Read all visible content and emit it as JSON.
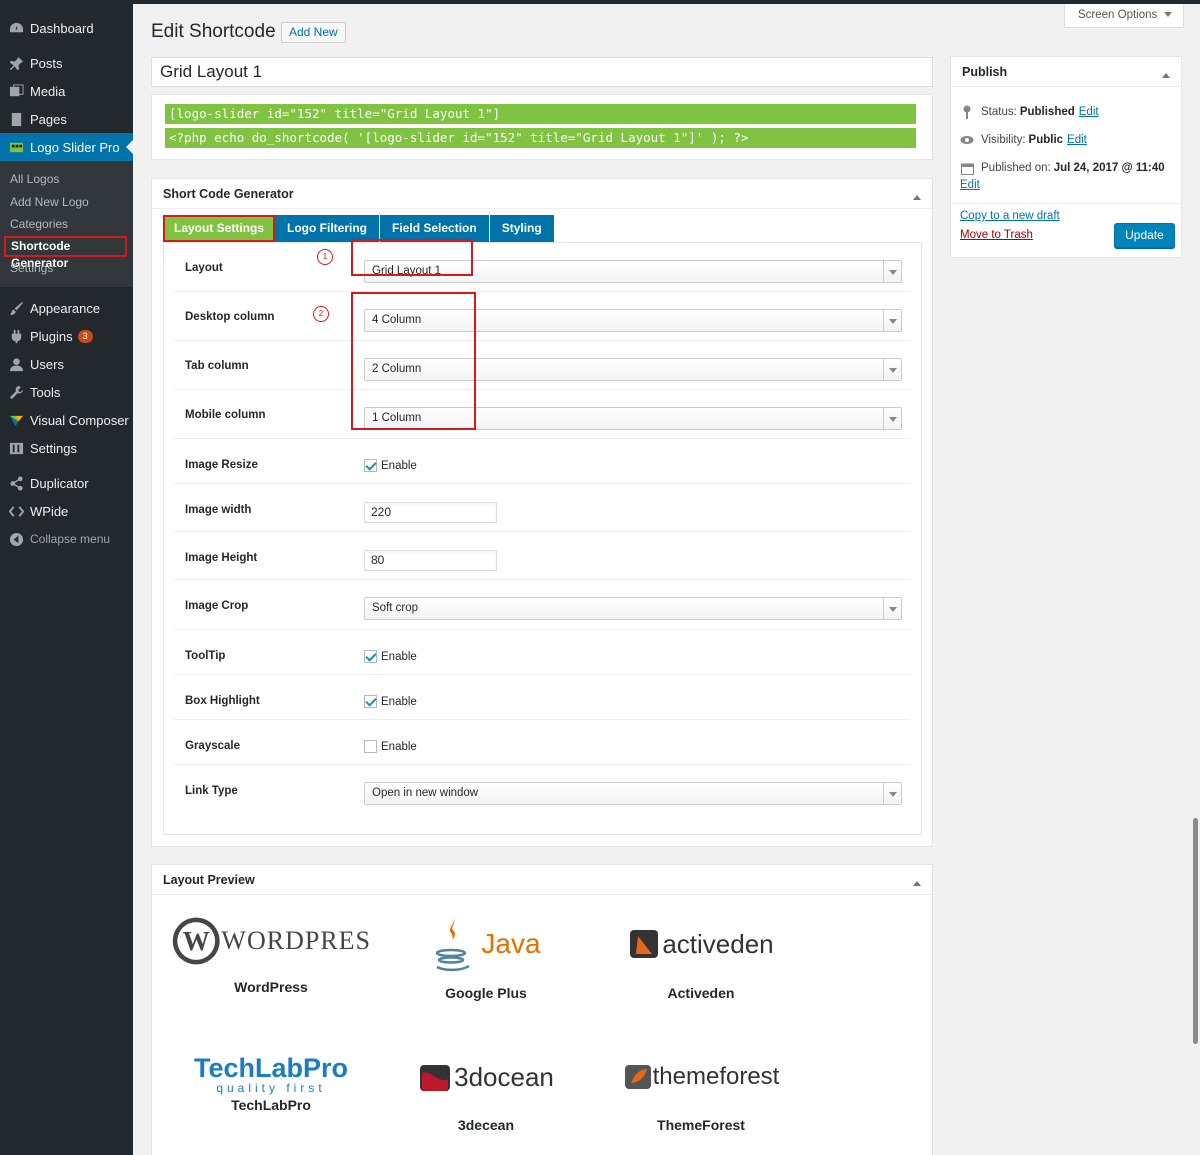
{
  "sidebar": {
    "items": [
      {
        "label": "Dashboard",
        "icon": "dashboard-icon"
      },
      {
        "label": "Posts",
        "icon": "pin-icon"
      },
      {
        "label": "Media",
        "icon": "media-icon"
      },
      {
        "label": "Pages",
        "icon": "pages-icon"
      },
      {
        "label": "Logo Slider Pro",
        "icon": "logo-slider-icon"
      }
    ],
    "submenu": [
      "All Logos",
      "Add New Logo",
      "Categories",
      "Shortcode Generator",
      "Settings"
    ],
    "items2": [
      {
        "label": "Appearance",
        "icon": "brush-icon"
      },
      {
        "label": "Plugins",
        "icon": "plugin-icon",
        "badge": "3"
      },
      {
        "label": "Users",
        "icon": "user-icon"
      },
      {
        "label": "Tools",
        "icon": "wrench-icon"
      },
      {
        "label": "Visual Composer",
        "icon": "vc-icon"
      },
      {
        "label": "Settings",
        "icon": "settings-icon"
      },
      {
        "label": "Duplicator",
        "icon": "share-icon"
      },
      {
        "label": "WPide",
        "icon": "code-icon"
      },
      {
        "label": "Collapse menu",
        "icon": "collapse-icon"
      }
    ]
  },
  "header": {
    "title": "Edit Shortcode",
    "add_new": "Add New",
    "screen_options": "Screen Options"
  },
  "post_title": "Grid Layout 1",
  "shortcodes": [
    "[logo-slider id=\"152\" title=\"Grid Layout 1\"]",
    "<?php echo do_shortcode( '[logo-slider id=\"152\" title=\"Grid Layout 1\"]' ); ?>"
  ],
  "generator": {
    "title": "Short Code Generator",
    "tabs": [
      "Layout Settings",
      "Logo Filtering",
      "Field Selection",
      "Styling"
    ],
    "fields": {
      "layout": {
        "label": "Layout",
        "value": "Grid Layout 1"
      },
      "desktop": {
        "label": "Desktop column",
        "value": "4 Column"
      },
      "tab": {
        "label": "Tab column",
        "value": "2 Column"
      },
      "mobile": {
        "label": "Mobile column",
        "value": "1 Column"
      },
      "resize": {
        "label": "Image Resize",
        "option": "Enable",
        "checked": true
      },
      "width": {
        "label": "Image width",
        "value": "220"
      },
      "height": {
        "label": "Image Height",
        "value": "80"
      },
      "crop": {
        "label": "Image Crop",
        "value": "Soft crop"
      },
      "tooltip": {
        "label": "ToolTip",
        "option": "Enable",
        "checked": true
      },
      "highlight": {
        "label": "Box Highlight",
        "option": "Enable",
        "checked": true
      },
      "grayscale": {
        "label": "Grayscale",
        "option": "Enable",
        "checked": false
      },
      "link": {
        "label": "Link Type",
        "value": "Open in new window"
      }
    },
    "annotations": [
      "1",
      "2"
    ]
  },
  "publish": {
    "title": "Publish",
    "status_label": "Status:",
    "status_value": "Published",
    "visibility_label": "Visibility:",
    "visibility_value": "Public",
    "published_label": "Published on:",
    "published_value": "Jul 24, 2017 @ 11:40",
    "edit": "Edit",
    "copy_draft": "Copy to a new draft",
    "trash": "Move to Trash",
    "update": "Update"
  },
  "preview": {
    "title": "Layout Preview",
    "logos": [
      {
        "name": "WordPress",
        "logo_text": "WORDPRES"
      },
      {
        "name": "Google Plus",
        "logo_text": "Java"
      },
      {
        "name": "Activeden",
        "logo_text": "activeden"
      },
      {
        "name": "TechLabPro",
        "logo_text": "TechLabPro",
        "tagline": "quality first"
      },
      {
        "name": "3decean",
        "logo_text": "3docean"
      },
      {
        "name": "ThemeForest",
        "logo_text": "themeforest"
      }
    ]
  },
  "colors": {
    "accent": "#0073aa",
    "green": "#80c342",
    "annotation": "#d31b1b",
    "sidebar": "#23282d"
  }
}
